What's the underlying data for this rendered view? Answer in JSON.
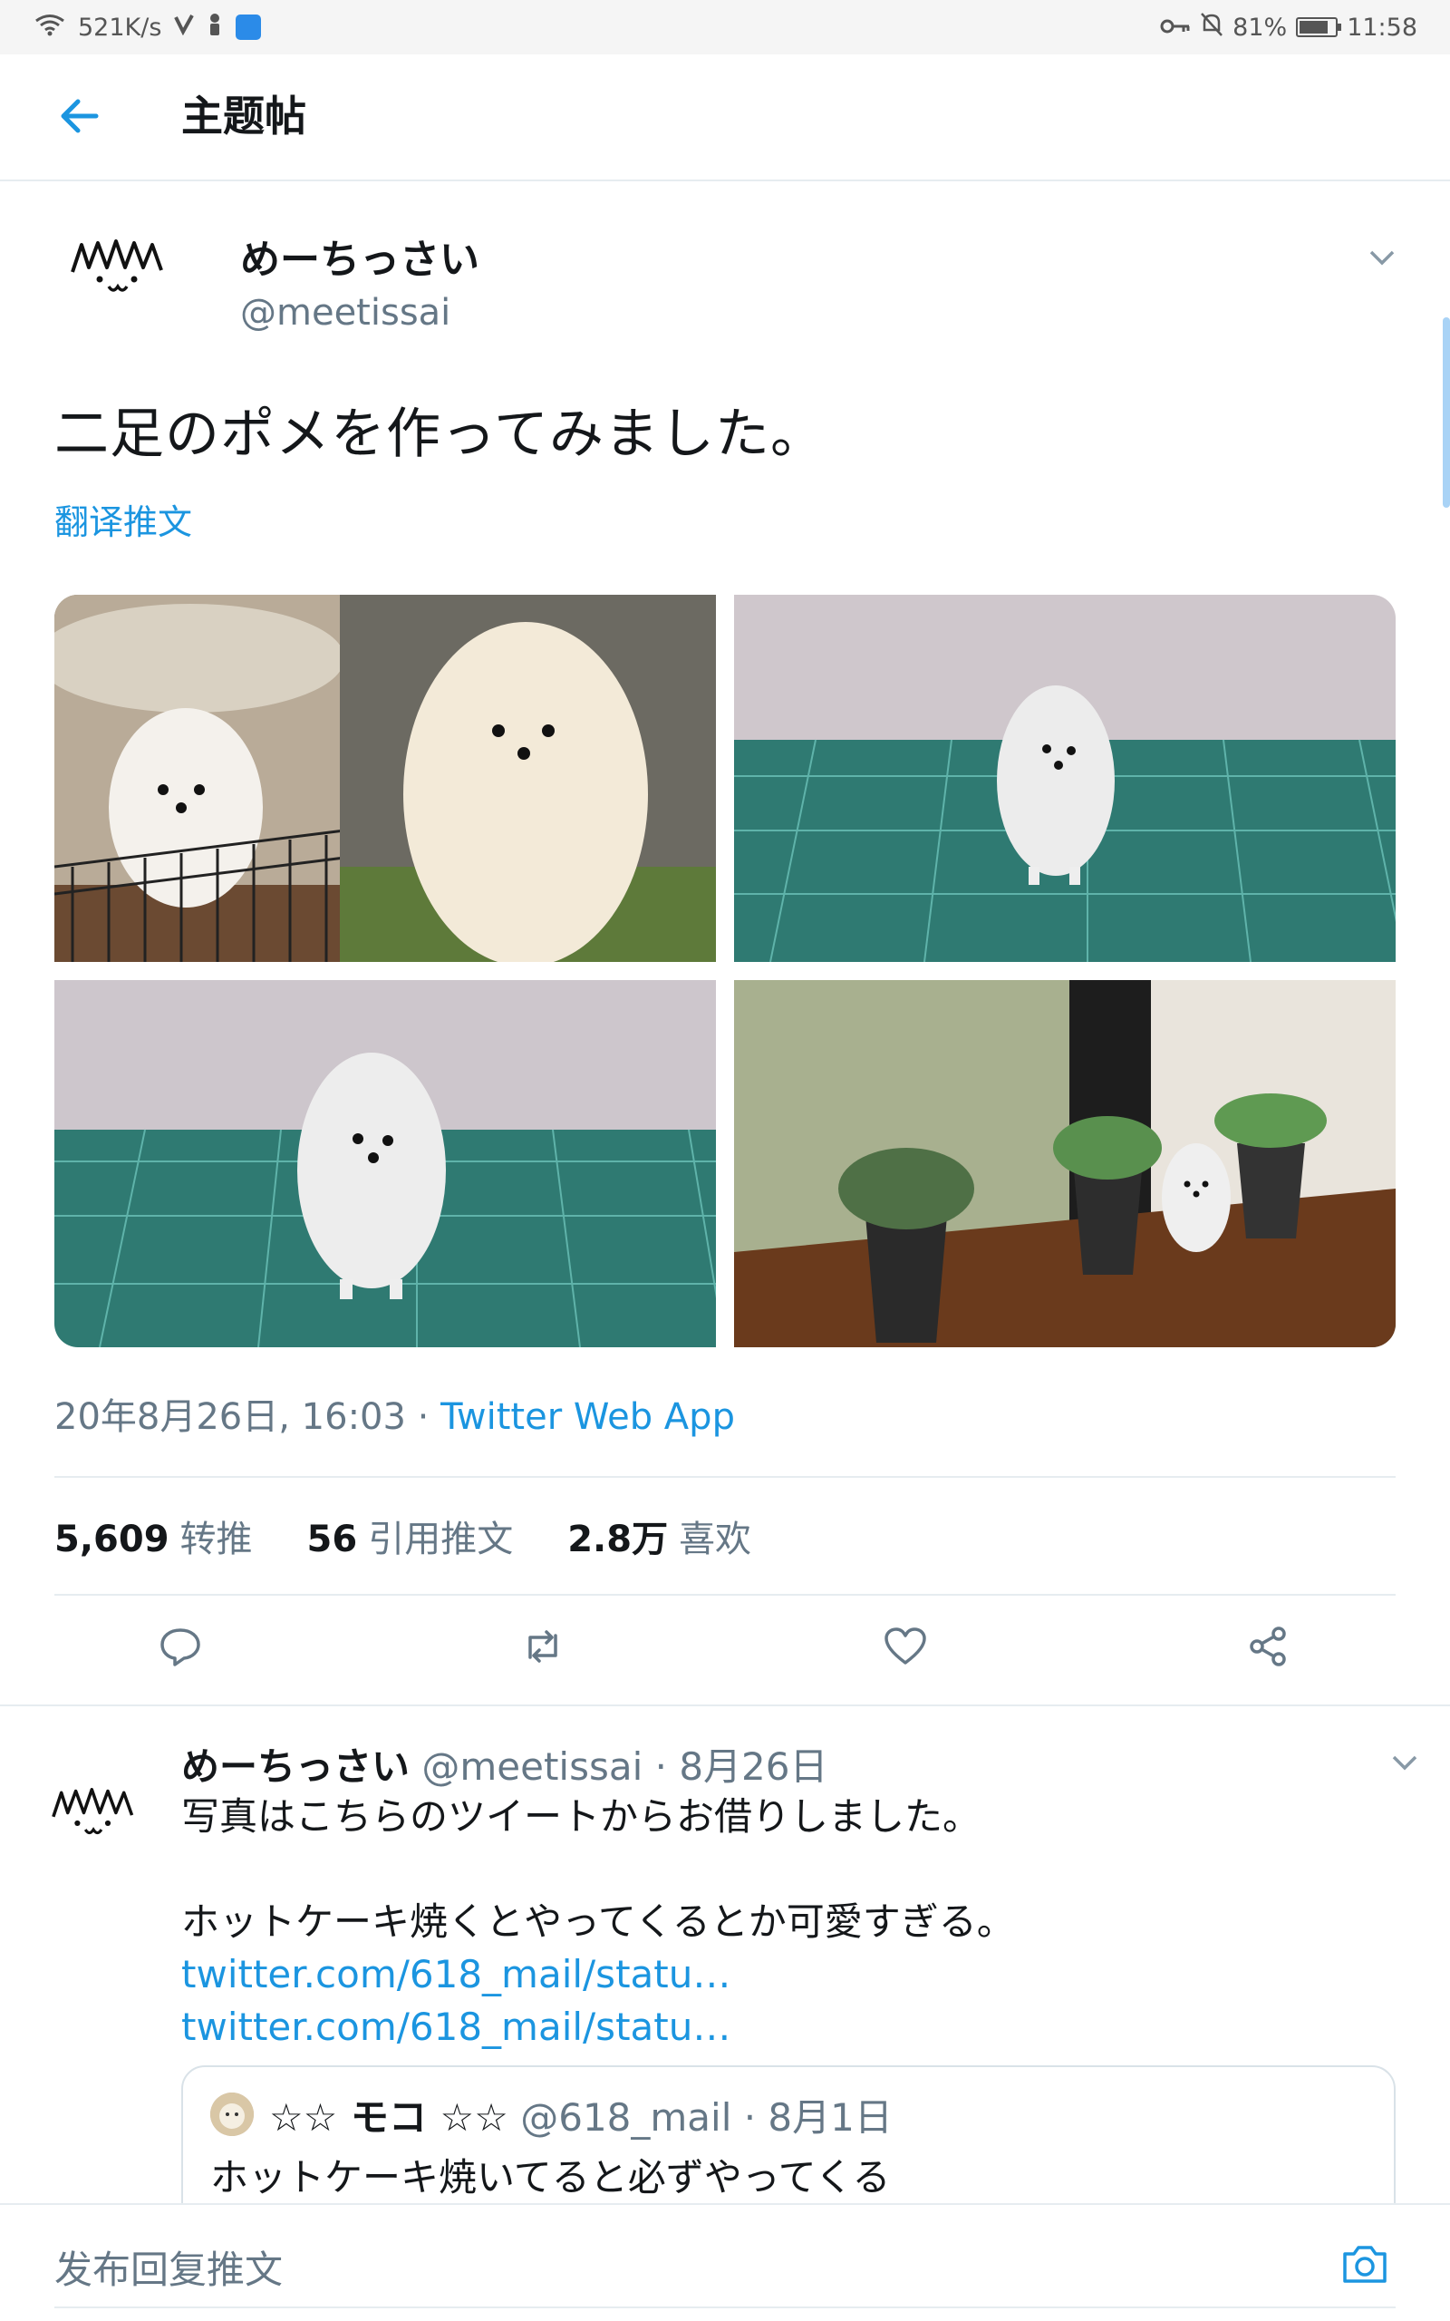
{
  "status_bar": {
    "speed": "521K/s",
    "battery": "81%",
    "battery_level": 0.81,
    "time": "11:58"
  },
  "header": {
    "title": "主题帖"
  },
  "tweet": {
    "author_name": "めーちっさい",
    "author_handle": "@meetissai",
    "text": "二足のポメを作ってみました。",
    "translate_label": "翻译推文",
    "timestamp": "20年8月26日, 16:03",
    "separator": " · ",
    "source": "Twitter Web App",
    "stats": {
      "retweets_value": "5,609",
      "retweets_label": "转推",
      "quotes_value": "56",
      "quotes_label": "引用推文",
      "likes_value": "2.8万",
      "likes_label": "喜欢"
    }
  },
  "reply": {
    "author_name": "めーちっさい",
    "author_handle": "@meetissai",
    "date": " · 8月26日",
    "line1": "写真はこちらのツイートからお借りしました。",
    "line2": "ホットケーキ焼くとやってくるとか可愛すぎる。",
    "link1": "twitter.com/618_mail/statu…",
    "link2": "twitter.com/618_mail/statu…",
    "quote": {
      "name": "☆☆ モコ ☆☆",
      "handle": "@618_mail",
      "date": " · 8月1日",
      "text": "ホットケーキ焼いてると必ずやってくる"
    }
  },
  "compose": {
    "placeholder": "发布回复推文"
  },
  "colors": {
    "accent": "#1b95e0",
    "secondary_text": "#657786"
  }
}
